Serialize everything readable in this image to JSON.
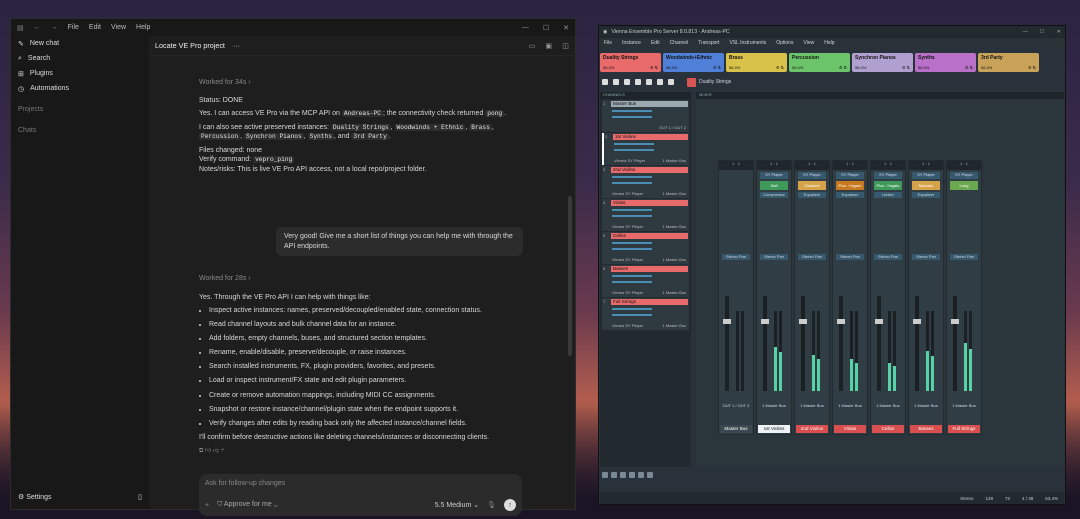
{
  "codex": {
    "menu": [
      "File",
      "Edit",
      "View",
      "Help"
    ],
    "sidebar": {
      "new_chat": "New chat",
      "search": "Search",
      "plugins": "Plugins",
      "automations": "Automations",
      "projects": "Projects",
      "chats": "Chats",
      "settings": "Settings"
    },
    "title": "Locate VE Pro project",
    "worked1": "Worked for 34s",
    "status": "Status: DONE",
    "p1a": "Yes. I can access VE Pro via the MCP API on",
    "p1b": "Andreas-PC",
    "p1c": "; the connectivity check returned",
    "p1d": "pong",
    "p1e": ".",
    "p2a": "I can also see active preserved instances:",
    "inst": [
      "Duality Strings",
      "Woodwinds + Ethnic",
      "Brass",
      "Percussion",
      "Synchron Pianos",
      "Synths",
      "3rd Party"
    ],
    "files": "Files changed: none",
    "verify": "Verify command:",
    "verify_cmd": "vepro_ping",
    "notes": "Notes/risks: This is live VE Pro API access, not a local repo/project folder.",
    "user_msg": "Very good! Give me a short list of things you can help me with through the API endpoints.",
    "worked2": "Worked for 28s",
    "intro": "Yes. Through the VE Pro API I can help with things like:",
    "bullets": [
      "Inspect active instances: names, preserved/decoupled/enabled state, connection status.",
      "Read channel layouts and bulk channel data for an instance.",
      "Add folders, empty channels, buses, and structured section templates.",
      "Rename, enable/disable, preserve/decouple, or raise instances.",
      "Search installed instruments, FX, plugin providers, favorites, and presets.",
      "Load or inspect instrument/FX state and edit plugin parameters.",
      "Create or remove automation mappings, including MIDI CC assignments.",
      "Snapshot or restore instance/channel/plugin state when the endpoint supports it.",
      "Verify changes after edits by reading back only the affected instance/channel fields."
    ],
    "closing": "I'll confirm before destructive actions like deleting channels/instances or disconnecting clients.",
    "composer_placeholder": "Ask for follow-up changes",
    "approve": "Approve for me",
    "model": "5.5 Medium"
  },
  "vepro": {
    "title": "Vienna Ensemble Pro Server 8.0.813 - Andreas-PC",
    "menu": [
      "File",
      "Instance",
      "Edit",
      "Channel",
      "Transport",
      "VSL Instruments",
      "Options",
      "View",
      "Help"
    ],
    "tabs": [
      {
        "name": "Duality Strings",
        "color": "#e86a6a"
      },
      {
        "name": "Woodwinds+Ethnic",
        "color": "#4f7fd6"
      },
      {
        "name": "Brass",
        "color": "#d8c24a"
      },
      {
        "name": "Percussion",
        "color": "#6cc46a"
      },
      {
        "name": "Synchron Pianos",
        "color": "#b0a0d0"
      },
      {
        "name": "Synths",
        "color": "#b870c8"
      },
      {
        "name": "3rd Party",
        "color": "#c9a25a"
      }
    ],
    "tab_pct": [
      "56.4%",
      "56.4%",
      "56.4%",
      "56.4%",
      "56.4%",
      "56.4%",
      "56.4%"
    ],
    "instance_label": "Duality Strings",
    "panel_channels": "CHANNELS",
    "panel_mixer": "MIXER",
    "channels": [
      {
        "n": "1",
        "name": "Master Bus",
        "plugin": "",
        "out": "OUT 1 / OUT 2",
        "color": "#9aa8b0"
      },
      {
        "n": "2",
        "name": "1st Violins",
        "plugin": "Vienna SY Player",
        "out": "1 Master Bus",
        "color": "#e86a6a"
      },
      {
        "n": "3",
        "name": "2nd Violins",
        "plugin": "Vienna SY Player",
        "out": "1 Master Bus",
        "color": "#e86a6a"
      },
      {
        "n": "4",
        "name": "Violas",
        "plugin": "Vienna SY Player",
        "out": "1 Master Bus",
        "color": "#e86a6a"
      },
      {
        "n": "5",
        "name": "Cellos",
        "plugin": "Vienna SY Player",
        "out": "1 Master Bus",
        "color": "#e86a6a"
      },
      {
        "n": "6",
        "name": "Basses",
        "plugin": "Vienna SY Player",
        "out": "1 Master Bus",
        "color": "#e86a6a"
      },
      {
        "n": "7",
        "name": "Full Strings",
        "plugin": "Vienna SY Player",
        "out": "1 Master Bus",
        "color": "#e86a6a"
      }
    ],
    "strips": [
      {
        "name": "Master Bus",
        "inst": "",
        "fx": "",
        "out": "OUT 1 / OUT 2",
        "db": "0.0",
        "meter": 0.0,
        "sel": false
      },
      {
        "name": "1st Violins",
        "inst": "Soft",
        "fx": "Compressor",
        "out": "1 Master Bus",
        "db": "-3.1",
        "meter": 0.55,
        "sel": true
      },
      {
        "name": "2nd Violins",
        "inst": "Octaved",
        "fx": "Equalizer",
        "out": "1 Master Bus",
        "db": "-3.8",
        "meter": 0.45,
        "sel": false
      },
      {
        "name": "Violas",
        "inst": "Pizz. / legato",
        "fx": "Equalizer",
        "out": "1 Master Bus",
        "db": "-2.5",
        "meter": 0.4,
        "sel": false
      },
      {
        "name": "Cellos",
        "inst": "Pizz. / legato",
        "fx": "Limiter",
        "out": "1 Master Bus",
        "db": "-1.4",
        "meter": 0.35,
        "sel": false
      },
      {
        "name": "Basses",
        "inst": "Marcato",
        "fx": "Equalizer",
        "out": "1 Master Bus",
        "db": "-0.5",
        "meter": 0.5,
        "sel": false
      },
      {
        "name": "Full Strings",
        "inst": "Long",
        "fx": "",
        "out": "1 Master Bus",
        "db": "0.0",
        "meter": 0.6,
        "sel": false
      }
    ],
    "status": [
      "Stereo",
      "128",
      "72",
      "4 / 38",
      "53.4%"
    ]
  }
}
